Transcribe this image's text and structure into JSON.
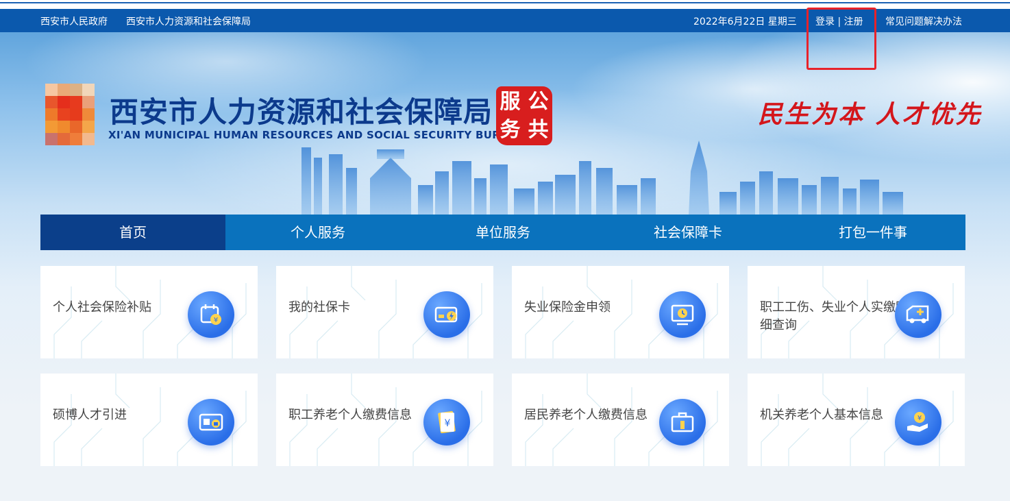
{
  "topbar": {
    "gov_link": "西安市人民政府",
    "bureau_link": "西安市人力资源和社会保障局",
    "date": "2022年6月22日 星期三",
    "login_register": "登录 | 注册",
    "faq": "常见问题解决办法"
  },
  "header": {
    "title_cn": "西安市人力资源和社会保障局",
    "title_en": "XI'AN MUNICIPAL HUMAN RESOURCES AND SOCIAL SECURITY BUREAU",
    "seal": [
      "服",
      "公",
      "务",
      "共"
    ],
    "slogan": "民生为本 人才优先"
  },
  "nav": {
    "items": [
      {
        "label": "首页",
        "active": true
      },
      {
        "label": "个人服务",
        "active": false
      },
      {
        "label": "单位服务",
        "active": false
      },
      {
        "label": "社会保障卡",
        "active": false
      },
      {
        "label": "打包一件事",
        "active": false
      }
    ]
  },
  "cards": [
    {
      "label": "个人社会保险补贴",
      "icon": "calendar-yuan-icon"
    },
    {
      "label": "我的社保卡",
      "icon": "card-lightning-icon"
    },
    {
      "label": "失业保险金申领",
      "icon": "monitor-clock-icon"
    },
    {
      "label": "职工工伤、失业个人实缴明细查询",
      "icon": "ambulance-icon"
    },
    {
      "label": "硕博人才引进",
      "icon": "id-card-icon"
    },
    {
      "label": "职工养老个人缴费信息",
      "icon": "document-yuan-icon"
    },
    {
      "label": "居民养老个人缴费信息",
      "icon": "briefcase-icon"
    },
    {
      "label": "机关养老个人基本信息",
      "icon": "hand-coin-icon"
    }
  ],
  "colors": {
    "topbar": "#0b59ad",
    "nav": "#0a72bd",
    "nav_active": "#0b3f8a",
    "highlight": "#e8222a",
    "seal": "#d81e1e"
  }
}
